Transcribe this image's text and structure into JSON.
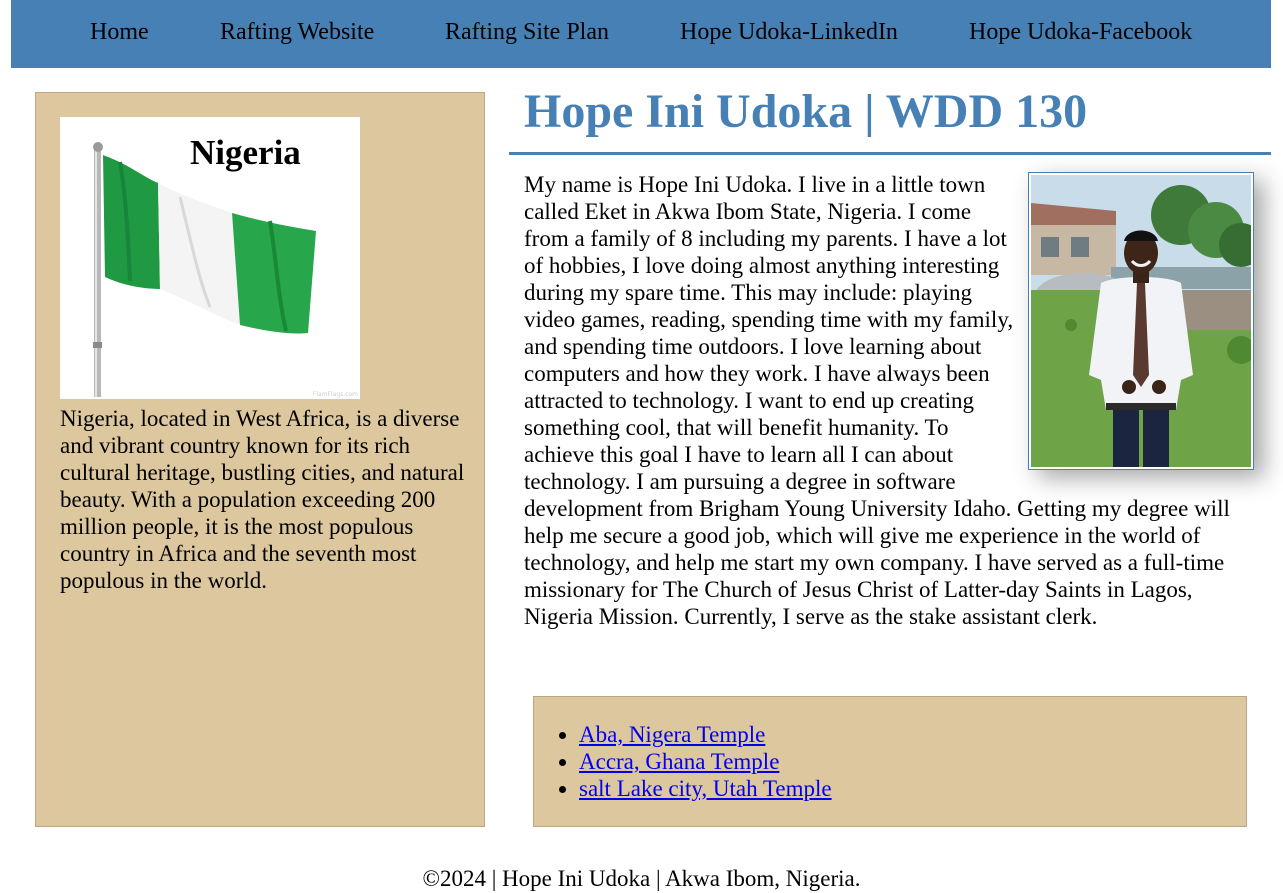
{
  "nav": {
    "items": [
      {
        "label": "Home"
      },
      {
        "label": "Rafting Website"
      },
      {
        "label": "Rafting Site Plan"
      },
      {
        "label": "Hope Udoka-LinkedIn"
      },
      {
        "label": "Hope Udoka-Facebook"
      }
    ]
  },
  "sidebar": {
    "flag_title": "Nigeria",
    "flag_watermark": "FlamFlags.com",
    "text": "Nigeria, located in West Africa, is a diverse and vibrant country known for its rich cultural heritage, bustling cities, and natural beauty. With a population exceeding 200 million people, it is the most populous country in Africa and the seventh most populous in the world."
  },
  "main": {
    "title": "Hope Ini Udoka | WDD 130",
    "bio": "My name is Hope Ini Udoka. I live in a little town called Eket in Akwa Ibom State, Nigeria. I come from a family of 8 including my parents. I have a lot of hobbies, I love doing almost anything interesting during my spare time. This may include: playing video games, reading, spending time with my family, and spending time outdoors. I love learning about computers and how they work. I have always been attracted to technology. I want to end up creating something cool, that will benefit humanity. To achieve this goal I have to learn all I can about technology. I am pursuing a degree in software development from Brigham Young University Idaho. Getting my degree will help me secure a good job, which will give me experience in the world of technology, and help me start my own company. I have served as a full-time missionary for The Church of Jesus Christ of Latter-day Saints in Lagos, Nigeria Mission. Currently, I serve as the stake assistant clerk."
  },
  "temples": {
    "items": [
      {
        "label": "Aba, Nigera Temple"
      },
      {
        "label": "Accra, Ghana Temple"
      },
      {
        "label": "salt Lake city, Utah Temple"
      }
    ]
  },
  "footer": {
    "text": "©2024 | Hope Ini Udoka | Akwa Ibom, Nigeria."
  },
  "colors": {
    "nav_bg": "#4680b4",
    "title": "#4680b4",
    "panel_bg": "#dcc79e",
    "link": "#0000ee",
    "flag_green": "#1f9a42",
    "flag_white": "#f4f4f4"
  }
}
